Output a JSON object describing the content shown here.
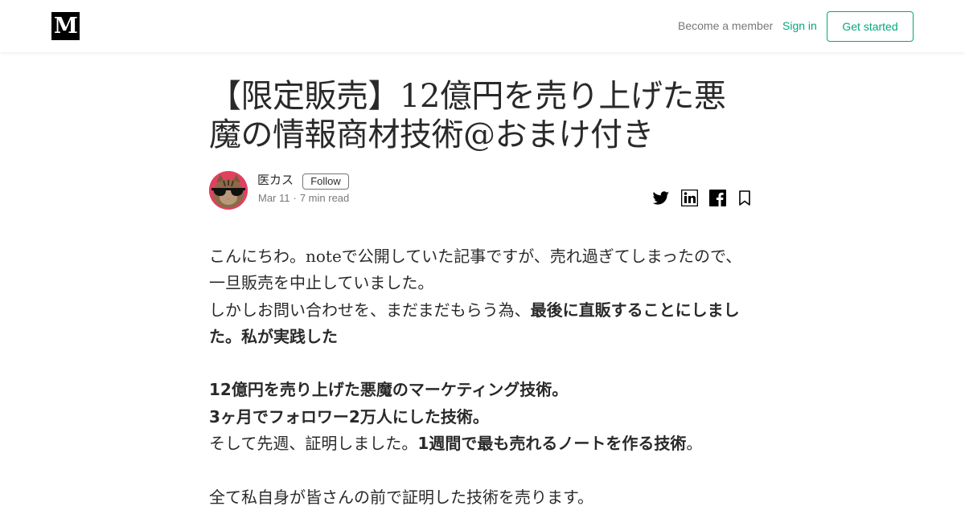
{
  "header": {
    "logo_text": "M",
    "become_member": "Become a member",
    "sign_in": "Sign in",
    "get_started": "Get started"
  },
  "article": {
    "title": "【限定販売】12億円を売り上げた悪魔の情報商材技術@おまけ付き",
    "author": {
      "name": "医カス",
      "follow_label": "Follow",
      "date": "Mar 11",
      "separator": "·",
      "read_time": "7 min read"
    },
    "share_icons": [
      "twitter-icon",
      "linkedin-icon",
      "facebook-icon",
      "bookmark-icon"
    ],
    "body": {
      "p1": "こんにちわ。noteで公開していた記事ですが、売れ過ぎてしまったので、一旦販売を中止していました。",
      "p2_plain": "しかしお問い合わせを、まだまだもらう為、",
      "p2_bold": "最後に直販することにしました。私が実践した",
      "p3_bold": "12億円を売り上げた悪魔のマーケティング技術。",
      "p4_bold": "3ヶ月でフォロワー2万人にした技術。",
      "p5_plain_a": "そして先週、証明しました。",
      "p5_bold": "1週間で最も売れるノートを作る技術",
      "p5_plain_b": "。",
      "p6": "全て私自身が皆さんの前で証明した技術を売ります。"
    }
  },
  "colors": {
    "accent": "#03a87c",
    "text": "rgba(0,0,0,0.84)",
    "muted": "rgba(0,0,0,0.54)",
    "avatar_bg": "#e0415f"
  }
}
